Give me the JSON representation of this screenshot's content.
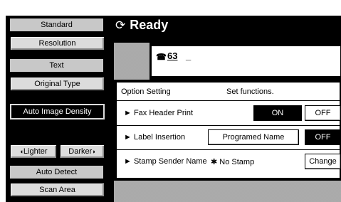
{
  "left_panel": {
    "standard_label": "Standard",
    "resolution_button": "Resolution",
    "text_label": "Text",
    "original_type_button": "Original Type",
    "auto_density_button": "Auto Image Density",
    "lighter_button": "Lighter",
    "darker_button": "Darker",
    "auto_detect_label": "Auto Detect",
    "scan_area_button": "Scan Area"
  },
  "status": {
    "text": "Ready",
    "icon": "spinner-icon"
  },
  "destination": {
    "line_number": "63",
    "cursor": "_"
  },
  "option_setting": {
    "title": "Option Setting",
    "instruction": "Set functions.",
    "rows": [
      {
        "label": "Fax Header Print",
        "options": [
          "ON",
          "OFF"
        ],
        "selected": "ON"
      },
      {
        "label": "Label Insertion",
        "options": [
          "Programed Name",
          "OFF"
        ],
        "selected": "OFF"
      },
      {
        "label": "Stamp Sender Name",
        "value": "No Stamp",
        "action": "Change"
      }
    ]
  },
  "colors": {
    "background": "#000000",
    "panel": "#ffffff",
    "button": "#dcdcdc",
    "selected": "#000000"
  }
}
